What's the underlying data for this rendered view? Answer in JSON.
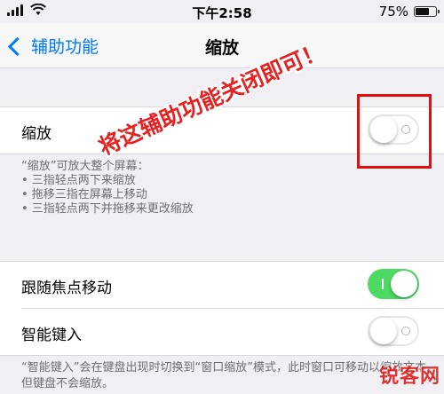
{
  "status_bar": {
    "time": "下午2:58",
    "battery_percent": "75%",
    "battery_level": 0.75
  },
  "nav": {
    "back_label": "辅助功能",
    "title": "缩放"
  },
  "zoom_group": {
    "label": "缩放",
    "toggle_on": false
  },
  "zoom_notes": [
    "“缩放”可放大整个屏幕：",
    "• 三指轻点两下来缩放",
    "• 拖移三指在屏幕上移动",
    "• 三指轻点两下并拖移来更改缩放"
  ],
  "settings_group": [
    {
      "label": "跟随焦点移动",
      "toggle_on": true
    },
    {
      "label": "智能键入",
      "toggle_on": false
    }
  ],
  "smart_typing_note": "“智能键入”会在键盘出现时切换到“窗口缩放”模式，此时窗口可移动以缩放文本，但键盘不会缩放。",
  "annotation": {
    "text": "将这辅助功能关闭即可！",
    "highlight_color": "#e01010"
  },
  "watermark": "锐客网",
  "colors": {
    "accent": "#007aff",
    "toggle_on": "#4cd964",
    "background": "#efeff4"
  }
}
